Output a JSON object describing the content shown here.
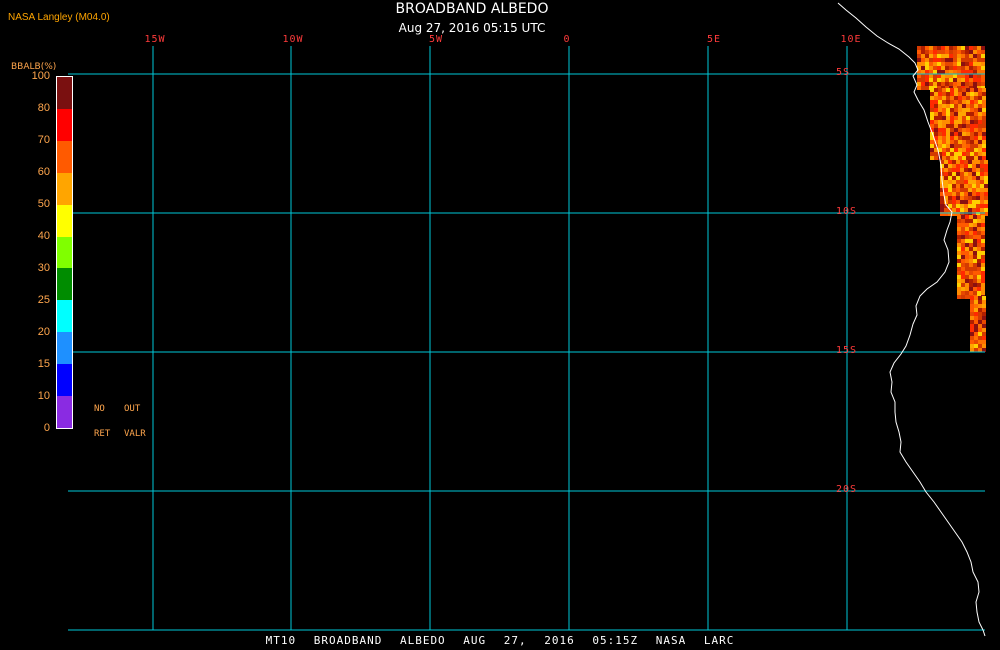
{
  "header": {
    "credit": "NASA Langley (M04.0)",
    "title": "BROADBAND ALBEDO",
    "datetime": "Aug 27, 2016 05:15 UTC"
  },
  "map": {
    "lon_labels": [
      "15W",
      "10W",
      "5W",
      "0",
      "5E",
      "10E"
    ],
    "lat_labels": [
      "5S",
      "10S",
      "15S",
      "20S"
    ],
    "grid_color": "#00c8d7",
    "label_color": "#ff3b3b",
    "coastline_color": "#ffffff"
  },
  "colorbar": {
    "title": "BBALB(%)",
    "ticks": [
      "100",
      "80",
      "70",
      "60",
      "50",
      "40",
      "30",
      "25",
      "20",
      "15",
      "10",
      "0"
    ],
    "colors": [
      "#7a1010",
      "#ff0000",
      "#ff5a00",
      "#ffa500",
      "#ffff00",
      "#80ff00",
      "#008c00",
      "#00ffff",
      "#1e90ff",
      "#0000ff",
      "#8a2be2"
    ],
    "no_label_1": "NO",
    "no_label_2": "RET",
    "out_label_1": "OUT",
    "out_label_2": "VALR"
  },
  "footer": {
    "text": "MT10  BROADBAND ALBEDO  AUG 27, 2016 05:15Z  NASA LARC"
  }
}
